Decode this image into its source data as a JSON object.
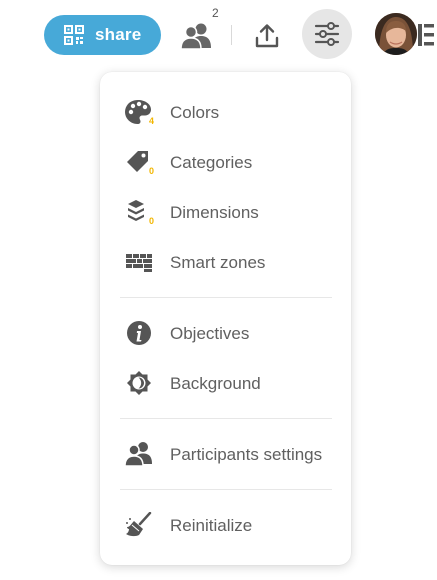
{
  "toolbar": {
    "share_label": "share",
    "participants_count": "2"
  },
  "colors": {
    "icon_gray": "#555555",
    "badge_yellow": "#f2b600",
    "accent": "#47a9d8"
  },
  "menu": {
    "items": [
      {
        "label": "Colors",
        "icon": "palette-icon",
        "badge": "4"
      },
      {
        "label": "Categories",
        "icon": "tag-icon",
        "badge": "0"
      },
      {
        "label": "Dimensions",
        "icon": "layers-icon",
        "badge": "0"
      },
      {
        "label": "Smart zones",
        "icon": "grid-zones-icon"
      },
      {
        "label": "Objectives",
        "icon": "info-icon"
      },
      {
        "label": "Background",
        "icon": "brightness-icon"
      },
      {
        "label": "Participants settings",
        "icon": "participants-icon"
      },
      {
        "label": "Reinitialize",
        "icon": "broom-icon"
      }
    ]
  }
}
